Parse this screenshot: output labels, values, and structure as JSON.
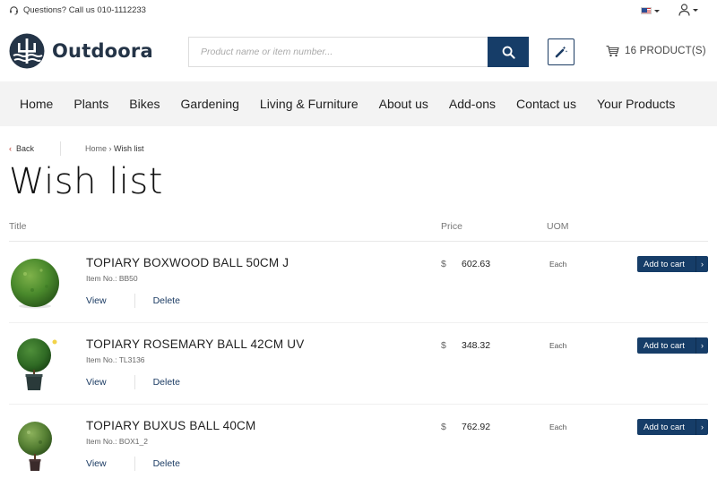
{
  "topbar": {
    "phone_text": "Questions? Call us 010-1112233"
  },
  "header": {
    "logo_text": "Outdoora",
    "search_placeholder": "Product name or item number...",
    "cart_text": "16 PRODUCT(S)"
  },
  "nav": {
    "items": [
      "Home",
      "Plants",
      "Bikes",
      "Gardening",
      "Living & Furniture",
      "About us",
      "Add-ons",
      "Contact us",
      "Your Products"
    ]
  },
  "breadcrumb": {
    "back_label": "Back",
    "home": "Home",
    "separator": "›",
    "current": "Wish list"
  },
  "page_title": "Wish list",
  "table": {
    "headers": {
      "title": "Title",
      "price": "Price",
      "uom": "UOM"
    },
    "rows": [
      {
        "name": "TOPIARY BOXWOOD BALL 50CM J",
        "item_no": "Item No.: BB50",
        "currency": "$",
        "price": "602.63",
        "uom": "Each",
        "add_label": "Add to cart",
        "view_label": "View",
        "delete_label": "Delete"
      },
      {
        "name": "TOPIARY ROSEMARY BALL 42CM UV",
        "item_no": "Item No.: TL3136",
        "currency": "$",
        "price": "348.32",
        "uom": "Each",
        "add_label": "Add to cart",
        "view_label": "View",
        "delete_label": "Delete"
      },
      {
        "name": "TOPIARY BUXUS BALL 40CM",
        "item_no": "Item No.: BOX1_2",
        "currency": "$",
        "price": "762.92",
        "uom": "Each",
        "add_label": "Add to cart",
        "view_label": "View",
        "delete_label": "Delete"
      }
    ]
  },
  "icons": {
    "phone": "headset-icon",
    "language": "us-flag-icon",
    "user": "user-icon",
    "search": "search-icon",
    "wand": "magic-wand-icon",
    "cart": "shopping-cart-icon"
  },
  "colors": {
    "brand_dark": "#163d68",
    "logo_text": "#243447",
    "nav_bg": "#f3f3f3",
    "back_chevron": "#c0392b"
  }
}
